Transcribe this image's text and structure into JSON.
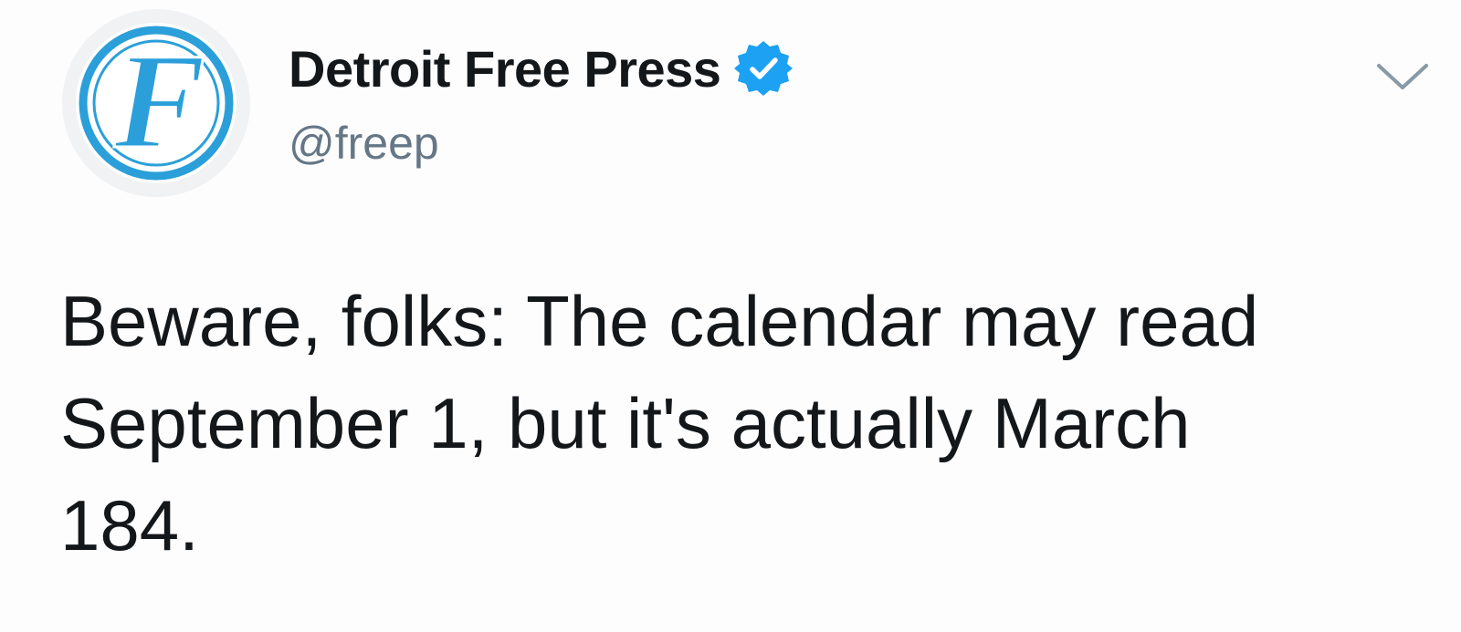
{
  "tweet": {
    "author": {
      "display_name": "Detroit Free Press",
      "handle": "@freep",
      "verified": true,
      "avatar_icon": "freep-logo-icon",
      "avatar_letter": "F"
    },
    "menu_icon": "chevron-down-icon",
    "text_lines": [
      "Beware, folks: The calendar may read",
      "September 1, but it's actually March",
      "184."
    ]
  },
  "colors": {
    "brand_blue": "#1da1f2",
    "logo_blue": "#2b9fd9",
    "text_primary": "#14171a",
    "text_secondary": "#657786",
    "caret_gray": "#8899a6"
  }
}
